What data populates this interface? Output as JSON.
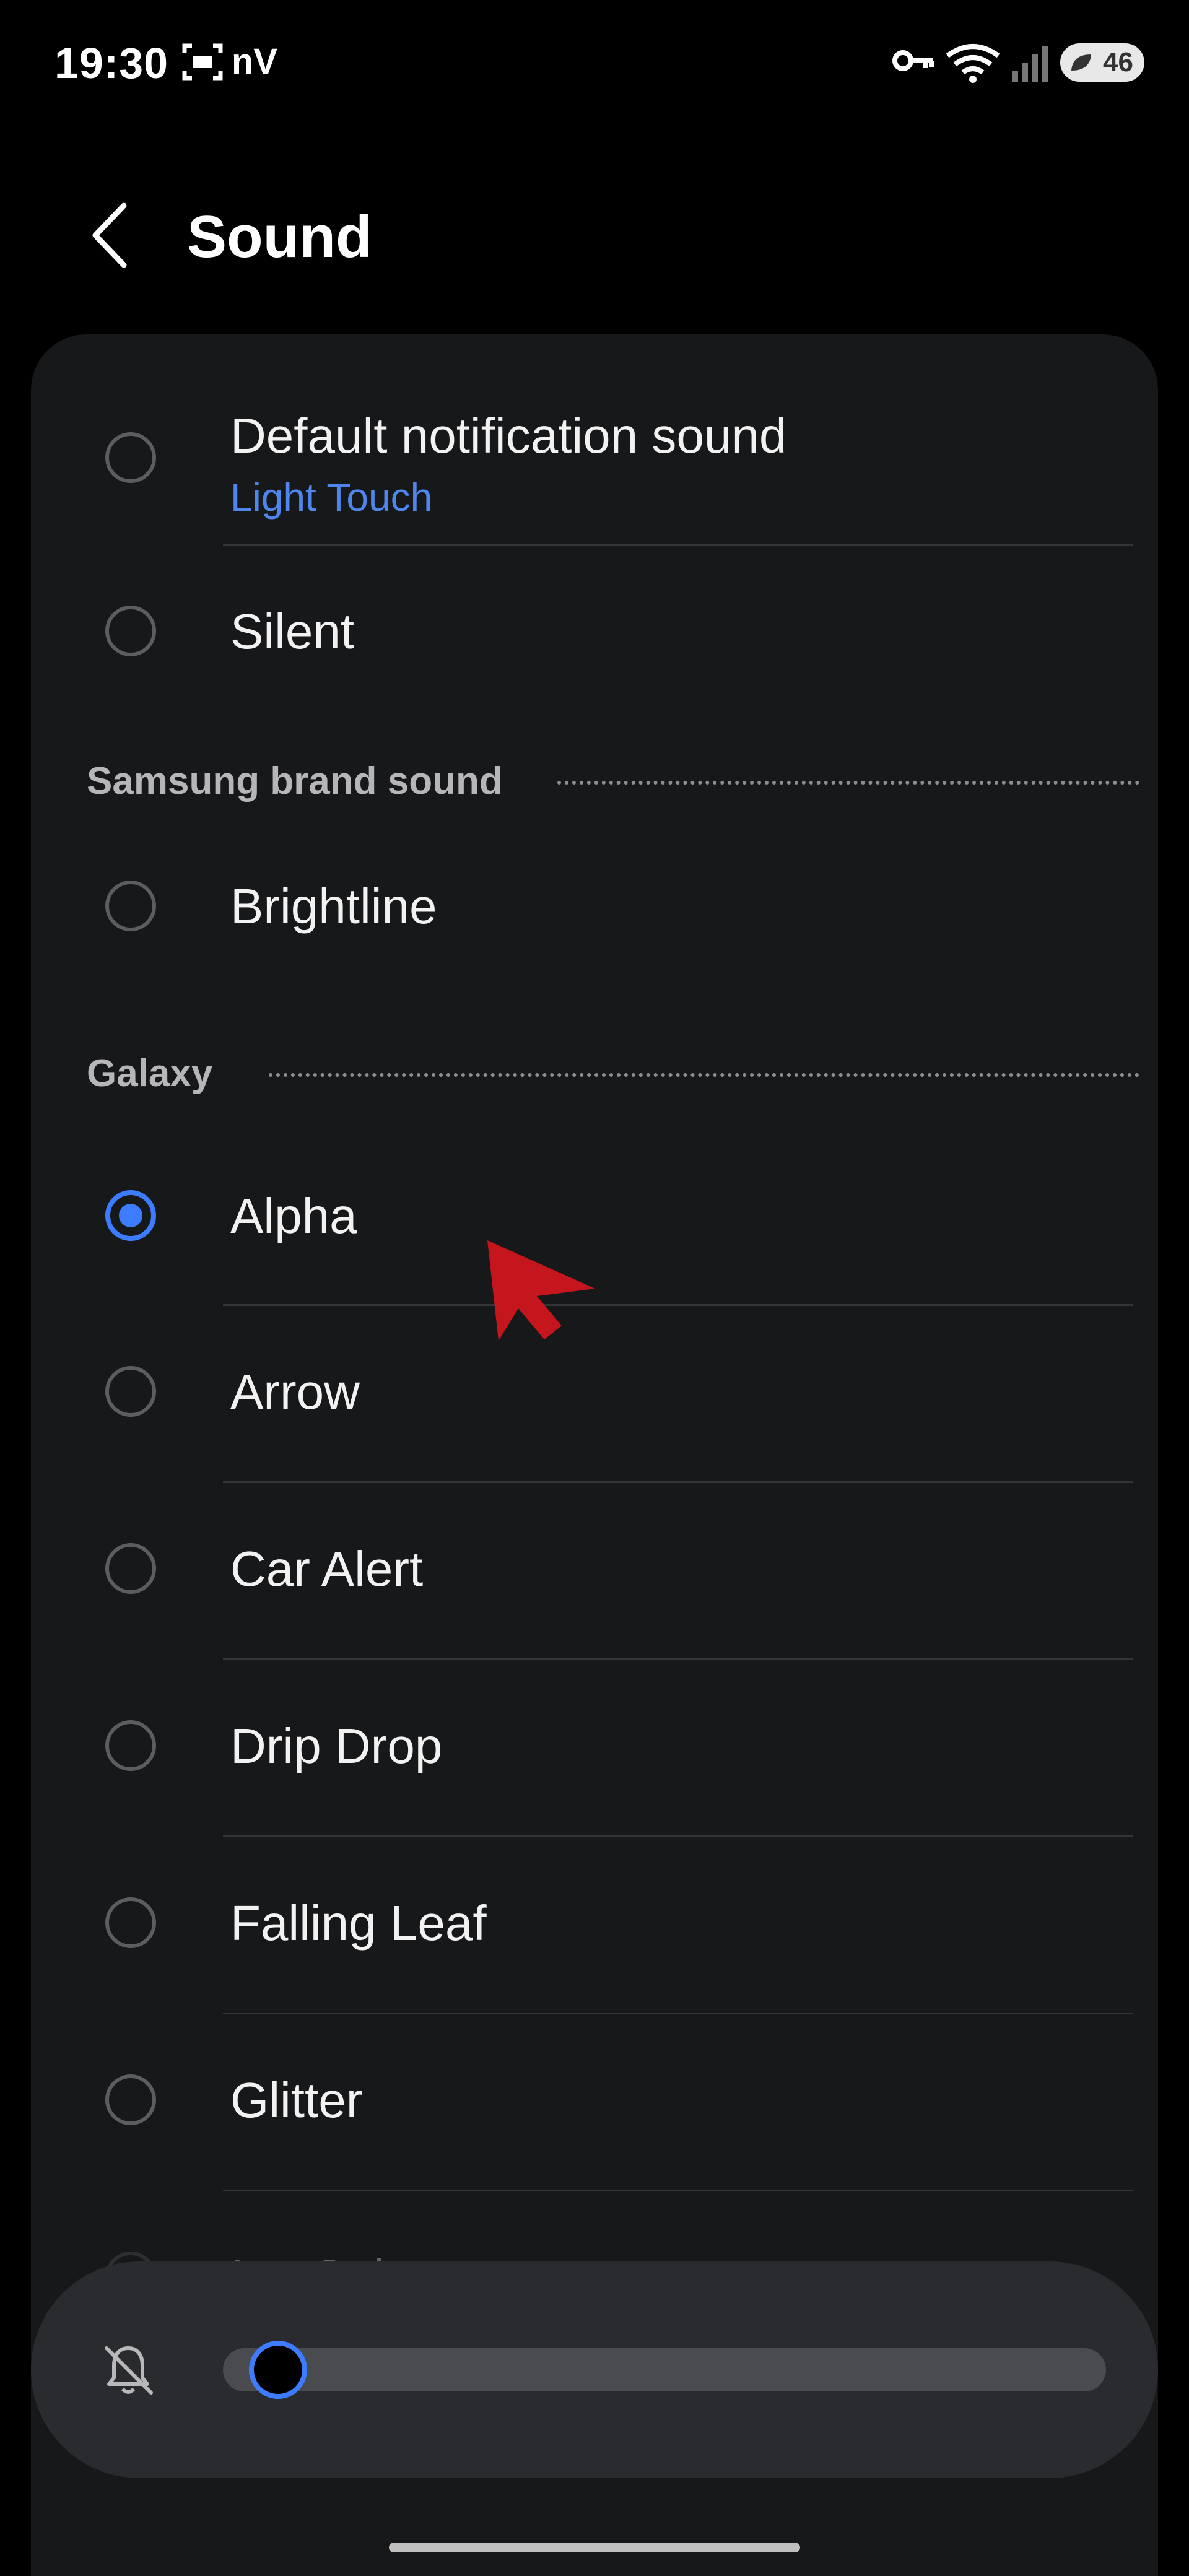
{
  "status_bar": {
    "time": "19:30",
    "carrier_glyph": "nV",
    "battery": "46",
    "icons": [
      "screenshot-icon",
      "key-icon",
      "wifi-icon",
      "signal-icon",
      "battery-icon"
    ]
  },
  "header": {
    "title": "Sound",
    "back_icon": "chevron-left-icon"
  },
  "list": {
    "items": [
      {
        "label": "Default notification sound",
        "sublabel": "Light Touch",
        "selected": false
      },
      {
        "label": "Silent",
        "selected": false
      }
    ],
    "sections": [
      {
        "title": "Samsung brand sound",
        "items": [
          {
            "label": "Brightline",
            "selected": false
          }
        ]
      },
      {
        "title": "Galaxy",
        "items": [
          {
            "label": "Alpha",
            "selected": true
          },
          {
            "label": "Arrow",
            "selected": false
          },
          {
            "label": "Car Alert",
            "selected": false
          },
          {
            "label": "Drip Drop",
            "selected": false
          },
          {
            "label": "Falling Leaf",
            "selected": false
          },
          {
            "label": "Glitter",
            "selected": false
          },
          {
            "label": "Ice Cubes",
            "selected": false
          }
        ]
      }
    ]
  },
  "volume": {
    "level": 0,
    "icon": "bell-muted-icon"
  },
  "colors": {
    "accent": "#3d7cff",
    "sublabel": "#4f86ee",
    "card": "#17181a",
    "panel": "#2a2b2e"
  }
}
